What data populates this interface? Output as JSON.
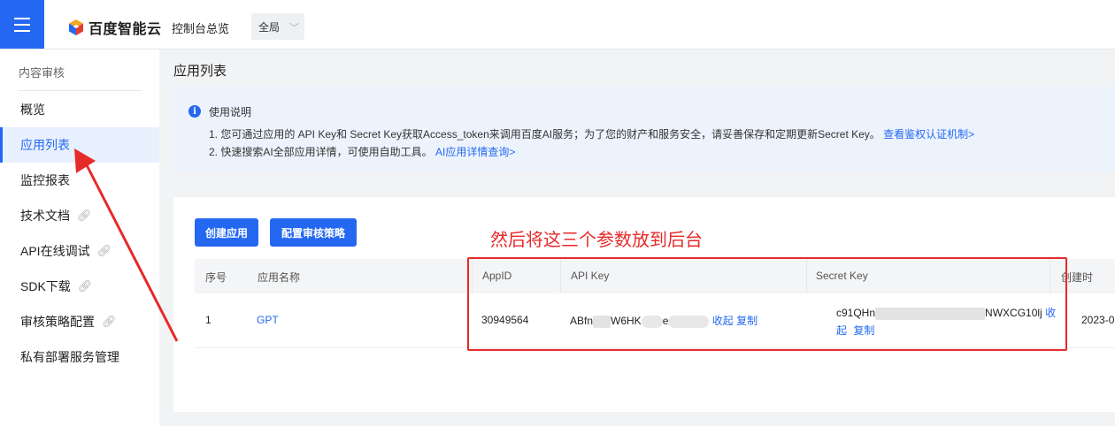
{
  "topbar": {
    "brand": "百度智能云",
    "console_overview": "控制台总览",
    "region": "全局"
  },
  "sidebar": {
    "section_title": "内容审核",
    "items": [
      {
        "label": "概览",
        "external": false,
        "active": false
      },
      {
        "label": "应用列表",
        "external": false,
        "active": true
      },
      {
        "label": "监控报表",
        "external": false,
        "active": false
      },
      {
        "label": "技术文档",
        "external": true,
        "active": false
      },
      {
        "label": "API在线调试",
        "external": true,
        "active": false
      },
      {
        "label": "SDK下载",
        "external": true,
        "active": false
      },
      {
        "label": "审核策略配置",
        "external": true,
        "active": false
      },
      {
        "label": "私有部署服务管理",
        "external": false,
        "active": false
      }
    ]
  },
  "main": {
    "page_title": "应用列表",
    "notice": {
      "title": "使用说明",
      "line1": "1. 您可通过应用的 API Key和 Secret Key获取Access_token来调用百度AI服务；为了您的财产和服务安全，请妥善保存和定期更新Secret Key。",
      "line1_link": "查看鉴权认证机制>",
      "line2": "2. 快速搜索AI全部应用详情，可使用自助工具。",
      "line2_link": "AI应用详情查询>"
    },
    "buttons": {
      "create_app": "创建应用",
      "config_policy": "配置审核策略"
    },
    "annotation": "然后将这三个参数放到后台",
    "table": {
      "headers": {
        "index": "序号",
        "app_name": "应用名称",
        "app_id": "AppID",
        "api_key": "API Key",
        "secret_key": "Secret Key",
        "created": "创建时"
      },
      "row": {
        "index": "1",
        "app_name": "GPT",
        "app_id": "30949564",
        "api_key_part1": "ABfn",
        "api_key_part2": "W6HK",
        "api_key_part3": "e",
        "api_key_collapse": "收起",
        "api_key_copy": "复制",
        "secret_key_part1": "c91QHn",
        "secret_key_part2": "NWXCG10lj",
        "secret_collapse_1": "收",
        "secret_collapse_2": "起",
        "secret_copy": "复制",
        "created": "2023-0"
      }
    }
  },
  "colors": {
    "primary": "#2468f2",
    "annotation_red": "#e62a2a",
    "notice_bg": "#edf3fd"
  }
}
